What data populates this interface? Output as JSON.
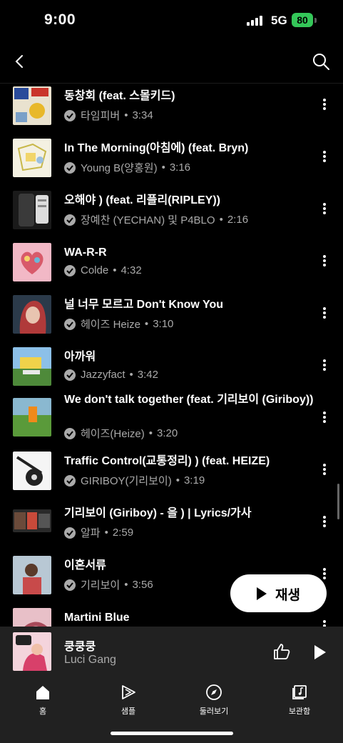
{
  "status_bar": {
    "time": "9:00",
    "network": "5G",
    "battery": "80"
  },
  "songs": [
    {
      "title": "동창회 (feat. 스몰키드)",
      "artist": "타임피버",
      "duration": "3:34"
    },
    {
      "title": "In The Morning(아침에) (feat. Bryn)",
      "artist": "Young B(양홍원)",
      "duration": "3:16"
    },
    {
      "title": "오해야 ) (feat. 리플리(RIPLEY))",
      "artist": "장예찬 (YECHAN) 및 P4BLO",
      "duration": "2:16"
    },
    {
      "title": "WA-R-R",
      "artist": "Colde",
      "duration": "4:32"
    },
    {
      "title": "널 너무 모르고 Don't Know You",
      "artist": "헤이즈 Heize",
      "duration": "3:10"
    },
    {
      "title": "아까워",
      "artist": "Jazzyfact",
      "duration": "3:42"
    },
    {
      "title": "We don't talk together (feat. 기리보이 (Giriboy))",
      "artist": "헤이즈(Heize)",
      "duration": "3:20"
    },
    {
      "title": "Traffic Control(교통정리) ) (feat. HEIZE)",
      "artist": "GIRIBOY(기리보이)",
      "duration": "3:19"
    },
    {
      "title": "기리보이 (Giriboy) - 을 ) | Lyrics/가사",
      "artist": "알파",
      "duration": "2:59"
    },
    {
      "title": "이혼서류",
      "artist": "기리보이",
      "duration": "3:56"
    },
    {
      "title": "Martini Blue",
      "artist": "",
      "duration": ""
    }
  ],
  "play_button": {
    "label": "재생"
  },
  "mini_player": {
    "title": "쿵쿵쿵",
    "artist": "Luci Gang"
  },
  "nav": {
    "home": "홈",
    "samples": "샘플",
    "explore": "둘러보기",
    "library": "보관함"
  }
}
